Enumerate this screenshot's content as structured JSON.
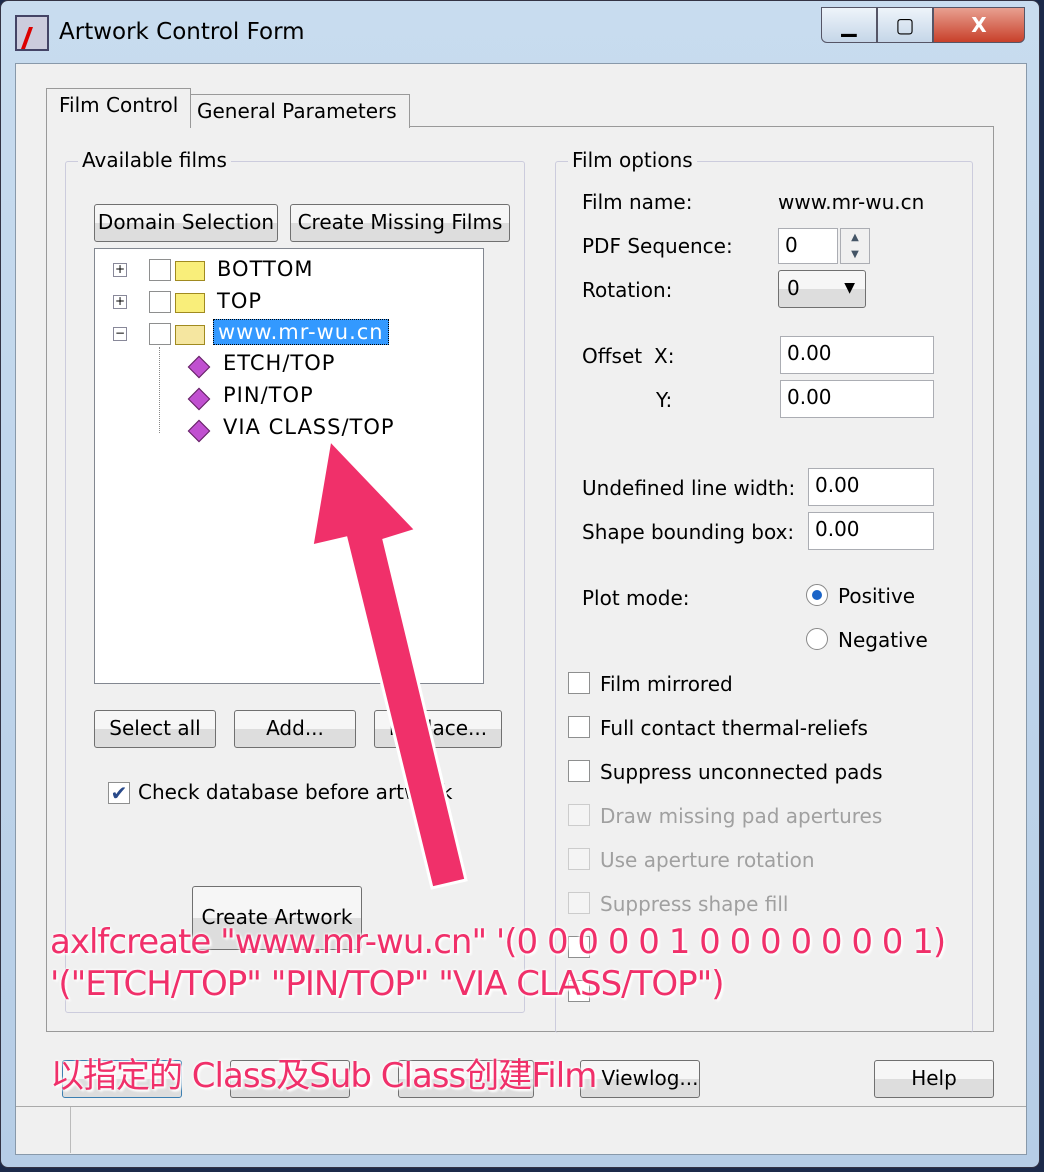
{
  "window": {
    "title": "Artwork Control Form"
  },
  "tabs": [
    {
      "label": "Film Control",
      "active": true
    },
    {
      "label": "General Parameters",
      "active": false
    }
  ],
  "available_films": {
    "label": "Available films",
    "domain_selection": "Domain Selection",
    "create_missing": "Create Missing Films",
    "tree": [
      {
        "name": "BOTTOM",
        "expanded": false,
        "checked": false
      },
      {
        "name": "TOP",
        "expanded": false,
        "checked": false
      },
      {
        "name": "www.mr-wu.cn",
        "expanded": true,
        "checked": false,
        "selected": true,
        "children": [
          "ETCH/TOP",
          "PIN/TOP",
          "VIA CLASS/TOP"
        ]
      }
    ],
    "select_all": "Select all",
    "add": "Add...",
    "replace": "Replace...",
    "check_db": {
      "label": "Check database before artwork",
      "checked": true
    },
    "create_artwork": "Create Artwork"
  },
  "film_options": {
    "label": "Film options",
    "film_name_label": "Film name:",
    "film_name": "www.mr-wu.cn",
    "pdf_seq_label": "PDF Sequence:",
    "pdf_seq": "0",
    "rotation_label": "Rotation:",
    "rotation": "0",
    "offset_label": "Offset",
    "x_label": "X:",
    "x": "0.00",
    "y_label": "Y:",
    "y": "0.00",
    "undef_lw_label": "Undefined line width:",
    "undef_lw": "0.00",
    "shape_bb_label": "Shape bounding box:",
    "shape_bb": "0.00",
    "plot_mode_label": "Plot mode:",
    "positive": "Positive",
    "negative": "Negative",
    "plot_mode": "Positive",
    "checks": [
      {
        "label": "Film mirrored",
        "enabled": true
      },
      {
        "label": "Full contact thermal-reliefs",
        "enabled": true
      },
      {
        "label": "Suppress unconnected pads",
        "enabled": true
      },
      {
        "label": "Draw missing pad apertures",
        "enabled": false
      },
      {
        "label": "Use aperture rotation",
        "enabled": false
      },
      {
        "label": "Suppress shape fill",
        "enabled": false
      }
    ]
  },
  "bottom": {
    "viewlog": "Viewlog...",
    "help": "Help"
  },
  "annotation": {
    "line1": "axlfcreate \"www.mr-wu.cn\" '(0 0 0 0 0 1 0 0 0 0 0 0 0 1)",
    "line2": "'(\"ETCH/TOP\" \"PIN/TOP\" \"VIA CLASS/TOP\")",
    "line3": "以指定的 Class及Sub Class创建Film",
    "color": "#f0306a"
  }
}
